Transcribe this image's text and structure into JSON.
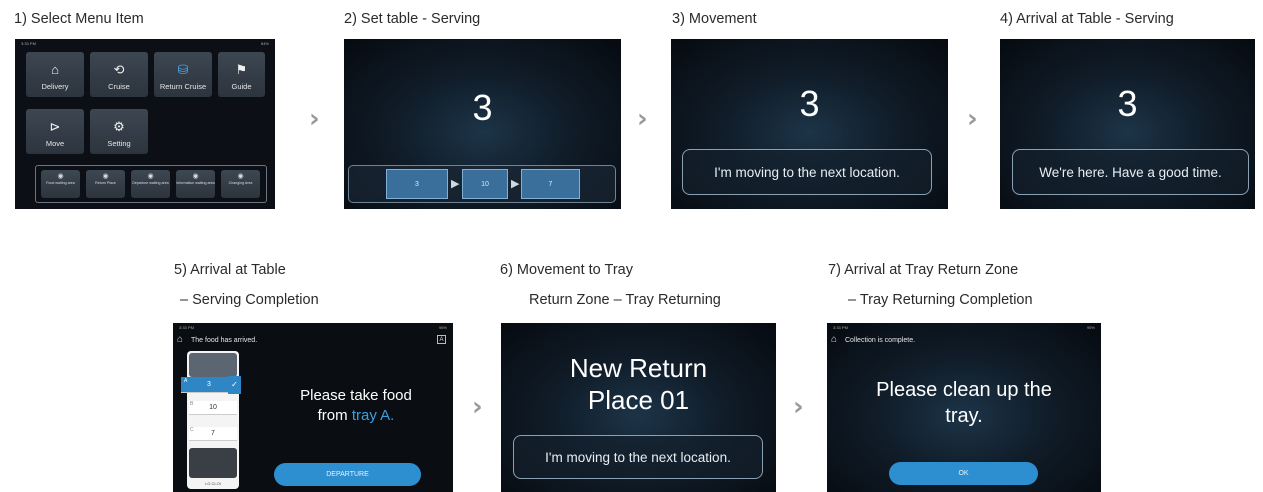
{
  "captions": {
    "step1": "1) Select Menu Item",
    "step2": "2) Set table - Serving",
    "step3": "3) Movement",
    "step4": "4) Arrival at Table - Serving",
    "step5_line1": "5) Arrival at Table",
    "step5_line2": "– Serving Completion",
    "step6_line1": "6)  Movement to Tray",
    "step6_line2": "Return Zone – Tray Returning",
    "step7_line1": "7) Arrival at Tray Return Zone",
    "step7_line2": "– Tray Returning Completion"
  },
  "arrow_glyph": "›",
  "menu_screen": {
    "time": "3:33 PM",
    "battery": "84%",
    "tiles": [
      {
        "label": "Delivery",
        "icon": "⌂"
      },
      {
        "label": "Cruise",
        "icon": "⟲"
      },
      {
        "label": "Return Cruise",
        "icon": "⛁"
      },
      {
        "label": "Guide",
        "icon": "⚑"
      },
      {
        "label": "Move",
        "icon": "⊳"
      },
      {
        "label": "Setting",
        "icon": "⚙"
      }
    ],
    "small_tiles": [
      {
        "label": "Food waiting area",
        "icon": "◉"
      },
      {
        "label": "Return Place",
        "icon": "◉"
      },
      {
        "label": "Departure waiting area",
        "icon": "◉"
      },
      {
        "label": "Information waiting area",
        "icon": "◉"
      },
      {
        "label": "Changing Area",
        "icon": "◉"
      }
    ]
  },
  "serving_screen": {
    "table_number": "3",
    "route": [
      "3",
      "10",
      "7"
    ]
  },
  "movement_screen": {
    "table_number": "3",
    "message": "I'm moving to the next location."
  },
  "arrival_screen": {
    "table_number": "3",
    "message": "We're here. Have a good time."
  },
  "completion_screen": {
    "time": "3:33 PM",
    "battery": "96%",
    "header": "The food has arrived.",
    "header_badge": "A",
    "trays": [
      {
        "letter": "A",
        "value": "3",
        "selected": true
      },
      {
        "letter": "B",
        "value": "10",
        "selected": false
      },
      {
        "letter": "C",
        "value": "7",
        "selected": false
      }
    ],
    "robot_label": "LG CLOI",
    "message_line1": "Please take food",
    "message_line2_prefix": "from ",
    "message_line2_highlight": "tray A.",
    "button": "DEPARTURE",
    "highlight_color": "#3aa0e0"
  },
  "return_screen": {
    "title_line1": "New Return",
    "title_line2": "Place 01",
    "message": "I'm moving to the next location."
  },
  "return_complete_screen": {
    "time": "3:33 PM",
    "battery": "95%",
    "header": "Collection is complete.",
    "message_line1": "Please clean up the",
    "message_line2": "tray.",
    "button": "OK"
  }
}
